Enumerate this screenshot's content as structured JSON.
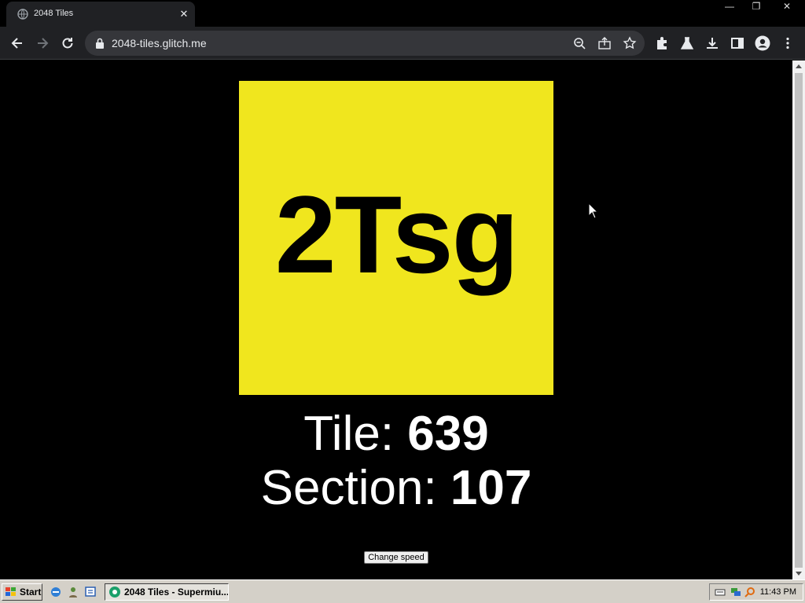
{
  "browser": {
    "tab_title": "2048 Tiles",
    "tab_close": "✕",
    "url": "2048-tiles.glitch.me",
    "window_controls": {
      "minimize": "—",
      "restore": "❐",
      "close": "✕"
    }
  },
  "page": {
    "tile_text": "2Tsg",
    "tile_color": "#f0e61e",
    "tile_label": "Tile: ",
    "tile_number": "639",
    "section_label": "Section: ",
    "section_number": "107",
    "change_speed_label": "Change speed"
  },
  "taskbar": {
    "start_label": "Start",
    "task_label": "2048 Tiles - Supermiu...",
    "clock": "11:43 PM"
  }
}
